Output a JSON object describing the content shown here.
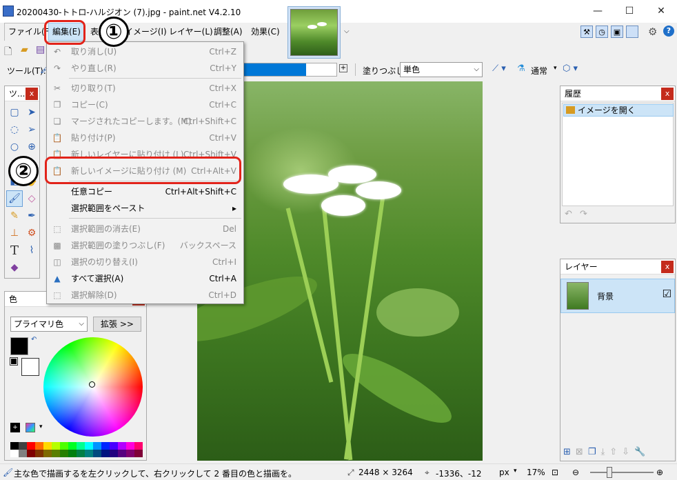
{
  "window": {
    "title": "20200430-トトロ-ハルジオン (7).jpg - paint.net V4.2.10",
    "minimize": "—",
    "maximize": "☐",
    "close": "✕"
  },
  "menubar": {
    "items": [
      {
        "label": "ファイル(F)"
      },
      {
        "label": "編集(E)"
      },
      {
        "label": "表示(V)"
      },
      {
        "label": "イメージ(I)"
      },
      {
        "label": "レイヤー(L)"
      },
      {
        "label": "調整(A)"
      },
      {
        "label": "効果(C)"
      }
    ]
  },
  "annotations": {
    "badge1": "①",
    "badge2": "②"
  },
  "toolbar": {
    "tool_label": "ツール(T):",
    "fill_label": "塗りつぶし:",
    "fill_value": "単色",
    "blend_value": "通常"
  },
  "edit_menu": {
    "items": [
      {
        "label": "取り消し(U)",
        "shortcut": "Ctrl+Z",
        "icon": "undo-icon",
        "state": "disabled"
      },
      {
        "label": "やり直し(R)",
        "shortcut": "Ctrl+Y",
        "icon": "redo-icon",
        "state": "disabled"
      },
      {
        "label": "切り取り(T)",
        "shortcut": "Ctrl+X",
        "icon": "scissors-icon",
        "state": "disabled"
      },
      {
        "label": "コピー(C)",
        "shortcut": "Ctrl+C",
        "icon": "copy-icon",
        "state": "disabled"
      },
      {
        "label": "マージされたコピーします。(M)",
        "shortcut": "Ctrl+Shift+C",
        "icon": "copy-merged-icon",
        "state": "disabled"
      },
      {
        "label": "貼り付け(P)",
        "shortcut": "Ctrl+V",
        "icon": "paste-icon",
        "state": "disabled"
      },
      {
        "label": "新しいレイヤーに貼り付け (L)",
        "shortcut": "Ctrl+Shift+V",
        "icon": "paste-new-layer-icon",
        "state": "disabled"
      },
      {
        "label": "新しいイメージに貼り付け (M)",
        "shortcut": "Ctrl+Alt+V",
        "icon": "paste-new-image-icon",
        "state": "disabled"
      },
      {
        "label": "任意コピー",
        "shortcut": "Ctrl+Alt+Shift+C",
        "icon": "",
        "state": "enabled"
      },
      {
        "label": "選択範囲をペースト",
        "shortcut": "▸",
        "icon": "",
        "state": "enabled"
      },
      {
        "label": "選択範囲の消去(E)",
        "shortcut": "Del",
        "icon": "erase-selection-icon",
        "state": "disabled"
      },
      {
        "label": "選択範囲の塗りつぶし(F)",
        "shortcut": "バックスペース",
        "icon": "fill-selection-icon",
        "state": "disabled"
      },
      {
        "label": "選択の切り替え(I)",
        "shortcut": "Ctrl+I",
        "icon": "invert-selection-icon",
        "state": "disabled"
      },
      {
        "label": "すべて選択(A)",
        "shortcut": "Ctrl+A",
        "icon": "select-all-icon",
        "state": "enabled"
      },
      {
        "label": "選択解除(D)",
        "shortcut": "Ctrl+D",
        "icon": "deselect-icon",
        "state": "disabled"
      }
    ]
  },
  "tools_panel": {
    "title": "ツ..."
  },
  "colors_panel": {
    "title": "色",
    "mode": "プライマリ色",
    "expand_button": "拡張 >>",
    "primary_color": "#000000",
    "secondary_color": "#ffffff"
  },
  "history_panel": {
    "title": "履歴",
    "items": [
      {
        "label": "イメージを開く"
      }
    ]
  },
  "layers_panel": {
    "title": "レイヤー",
    "layers": [
      {
        "name": "背景",
        "visible": "☑"
      }
    ]
  },
  "statusbar": {
    "hint": "主な色で描画するを左クリックして、右クリックして 2 番目の色と描画を。",
    "image_size": "2448 × 3264",
    "cursor_pos": "-1336、-12",
    "unit": "px",
    "zoom": "17%"
  },
  "colors": {
    "accent": "#0078d7",
    "highlight": "#cce4f7",
    "annotation_red": "#e2231a",
    "close_red": "#c42b1c"
  }
}
